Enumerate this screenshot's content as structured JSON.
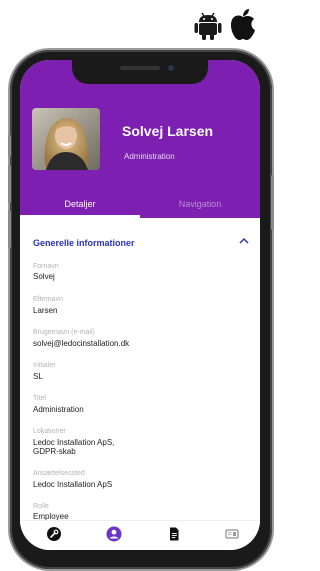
{
  "platforms": {
    "android": "android-icon",
    "apple": "apple-icon"
  },
  "profile": {
    "name": "Solvej Larsen",
    "role": "Administration"
  },
  "tabs": [
    {
      "label": "Detaljer",
      "active": true
    },
    {
      "label": "Navigation",
      "active": false
    }
  ],
  "section": {
    "title": "Generelle informationer",
    "expanded": true
  },
  "fields": [
    {
      "label": "Fornavn",
      "value": "Solvej"
    },
    {
      "label": "Efternavn",
      "value": "Larsen"
    },
    {
      "label": "Brugernavn (e-mail)",
      "value": "solvej@ledocinstallation.dk"
    },
    {
      "label": "Initialer",
      "value": "SL"
    },
    {
      "label": "Titel",
      "value": "Administration"
    },
    {
      "label": "Lokationer",
      "value": "Ledoc Installation ApS,",
      "value2": "GDPR-skab"
    },
    {
      "label": "Ansættelsessted",
      "value": "Ledoc Installation ApS"
    },
    {
      "label": "Rolle",
      "value": "Employee"
    }
  ],
  "bottom_nav": [
    "wrench-icon",
    "profile-icon",
    "document-icon",
    "id-card-icon"
  ],
  "colors": {
    "header": "#7d1fb0",
    "section_title": "#2c31b8",
    "active_nav": "#6a35c8"
  }
}
